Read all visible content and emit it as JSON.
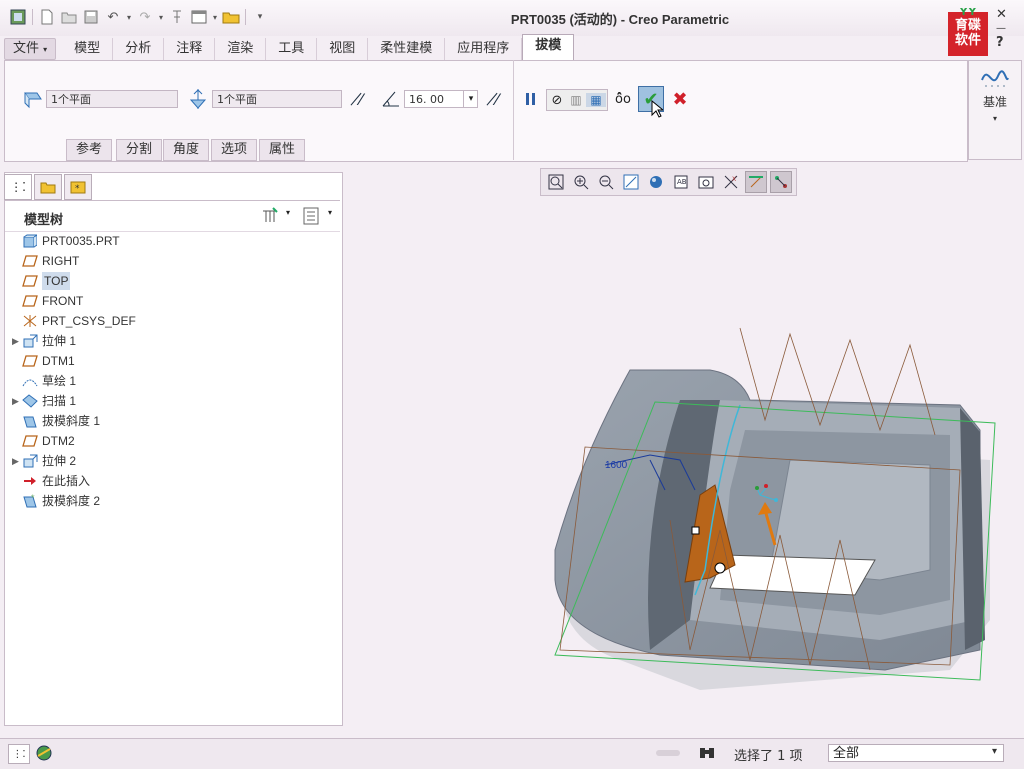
{
  "window": {
    "title": "PRT0035 (活动的) - Creo Parametric"
  },
  "logo": {
    "line1": "育碟",
    "line2": "软件"
  },
  "ribbon": {
    "file_label": "文件",
    "tabs": [
      "模型",
      "分析",
      "注释",
      "渲染",
      "工具",
      "视图",
      "柔性建模",
      "应用程序",
      "拔模"
    ],
    "active_tab": "拔模"
  },
  "draft": {
    "draft_surfaces": "1个平面",
    "draft_hinge": "1个平面",
    "angle": "16. 00",
    "subtabs": [
      "参考",
      "分割",
      "角度",
      "选项",
      "属性"
    ],
    "datum_label": "基准"
  },
  "model_tree": {
    "header": "模型树",
    "items": [
      {
        "label": "PRT0035.PRT",
        "icon": "part-icon",
        "expandable": false
      },
      {
        "label": "RIGHT",
        "icon": "datum-plane-icon",
        "expandable": false
      },
      {
        "label": "TOP",
        "icon": "datum-plane-icon",
        "expandable": false,
        "selected": true
      },
      {
        "label": "FRONT",
        "icon": "datum-plane-icon",
        "expandable": false
      },
      {
        "label": "PRT_CSYS_DEF",
        "icon": "csys-icon",
        "expandable": false
      },
      {
        "label": "拉伸 1",
        "icon": "extrude-icon",
        "expandable": true
      },
      {
        "label": "DTM1",
        "icon": "datum-plane-icon",
        "expandable": false
      },
      {
        "label": "草绘 1",
        "icon": "sketch-icon",
        "expandable": false
      },
      {
        "label": "扫描 1",
        "icon": "sweep-icon",
        "expandable": true
      },
      {
        "label": "拔模斜度 1",
        "icon": "draft-icon",
        "expandable": false
      },
      {
        "label": "DTM2",
        "icon": "datum-plane-icon",
        "expandable": false
      },
      {
        "label": "拉伸 2",
        "icon": "extrude-icon",
        "expandable": true
      },
      {
        "label": "在此插入",
        "icon": "insert-arrow-icon",
        "expandable": false
      },
      {
        "label": "拔模斜度 2",
        "icon": "draft-new-icon",
        "expandable": false
      }
    ]
  },
  "graphics": {
    "dimension_value": "1600"
  },
  "status": {
    "selection": "选择了 1 项",
    "filter": "全部"
  },
  "colors": {
    "accent": "#2f6fb5",
    "draft_face": "#b8651a",
    "confirm": "#2a9d3a",
    "cancel": "#d0202a"
  }
}
